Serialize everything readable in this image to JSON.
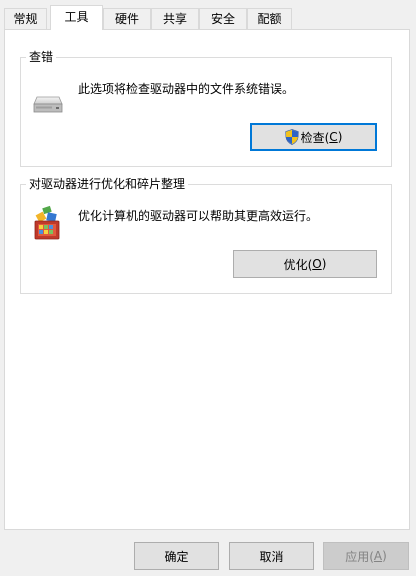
{
  "tabs": [
    {
      "label": "常规",
      "active": false
    },
    {
      "label": "工具",
      "active": true
    },
    {
      "label": "硬件",
      "active": false
    },
    {
      "label": "共享",
      "active": false
    },
    {
      "label": "安全",
      "active": false
    },
    {
      "label": "配额",
      "active": false
    }
  ],
  "error_check": {
    "title": "查错",
    "description": "此选项将检查驱动器中的文件系统错误。",
    "button": {
      "label": "检查(",
      "mnemonic": "C",
      "suffix": ")"
    },
    "icon": "drive-icon",
    "button_icon": "uac-shield-icon"
  },
  "optimize": {
    "title": "对驱动器进行优化和碎片整理",
    "description": "优化计算机的驱动器可以帮助其更高效运行。",
    "button": {
      "label": "优化(",
      "mnemonic": "O",
      "suffix": ")"
    },
    "icon": "defrag-icon"
  },
  "footer": {
    "ok": "确定",
    "cancel": "取消",
    "apply": {
      "label": "应用(",
      "mnemonic": "A",
      "suffix": ")",
      "enabled": false
    }
  },
  "colors": {
    "focus_border": "#0078d7",
    "button_face": "#e1e1e1",
    "window_bg": "#f0f0f0"
  }
}
